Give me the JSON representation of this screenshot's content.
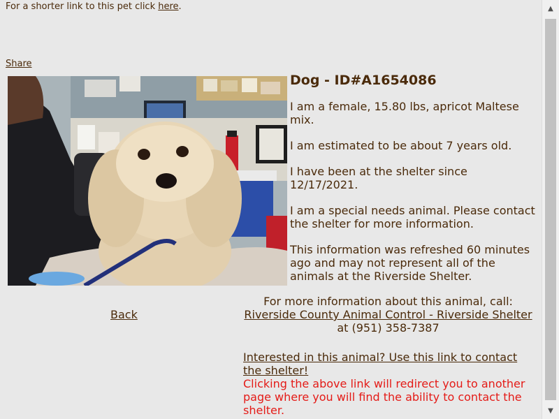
{
  "header": {
    "shortlink_text": "For a shorter link to this pet click ",
    "shortlink_link": "here",
    "shortlink_end": ".",
    "share_label": "Share"
  },
  "pet": {
    "title": "Dog - ID#A1654086",
    "description": "I am a female, 15.80 lbs, apricot Maltese mix.",
    "age": "I am estimated to be about 7 years old.",
    "shelter_since": "I have been at the shelter since 12/17/2021.",
    "special_needs": "I am a special needs animal. Please contact the shelter for more information.",
    "refresh_note": "This information was refreshed 60 minutes ago and may not represent all of the animals at the Riverside Shelter."
  },
  "nav": {
    "back_label": "Back"
  },
  "contact": {
    "prompt": "For more information about this animal, call:",
    "shelter_link": "Riverside County Animal Control - Riverside Shelter",
    "phone": " at (951) 358-7387",
    "interest_link": "Interested in this animal? Use this link to contact the shelter!",
    "redirect_note": "Clicking the above link will redirect you to another page where you will find the ability to contact the shelter."
  },
  "colors": {
    "background": "#e8e8e8",
    "text": "#4a2a0a",
    "warning": "#e41b17"
  }
}
